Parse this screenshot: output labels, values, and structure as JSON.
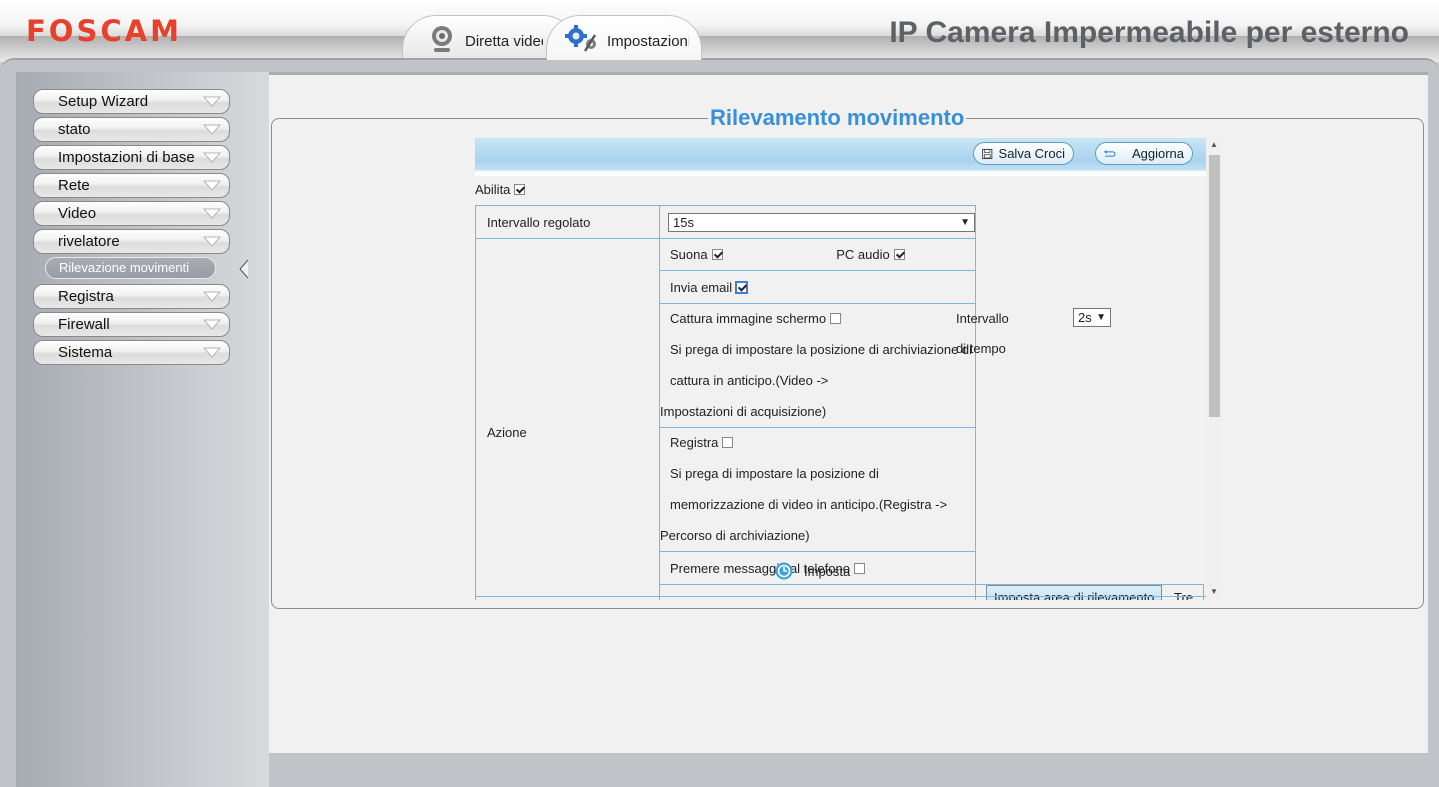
{
  "header": {
    "logo": "FOSCAM",
    "app_title": "IP Camera Impermeabile per esterno",
    "tabs": [
      {
        "label": "Diretta video",
        "icon": "webcam-icon"
      },
      {
        "label": "Impostazioni",
        "icon": "gears-icon"
      }
    ]
  },
  "sidebar": {
    "items": [
      {
        "label": "Setup Wizard"
      },
      {
        "label": "stato"
      },
      {
        "label": "Impostazioni di base"
      },
      {
        "label": "Rete"
      },
      {
        "label": "Video"
      },
      {
        "label": "rivelatore"
      },
      {
        "label": "Registra"
      },
      {
        "label": "Firewall"
      },
      {
        "label": "Sistema"
      }
    ],
    "active_sub": "Rilevazione movimenti"
  },
  "main": {
    "title": "Rilevamento movimento",
    "toolbar": {
      "save_label": "Salva Croci",
      "refresh_label": "Aggiorna"
    },
    "enable_label": "Abilita",
    "interval_label": "Intervallo regolato",
    "interval_value": "15s",
    "action_label": "Azione",
    "sound_label": "Suona",
    "pc_audio_label": "PC audio",
    "email_label": "Invia email",
    "snapshot_label": "Cattura immagine schermo",
    "time_interval_label": "Intervallo di tempo",
    "time_interval_value": "2s",
    "snapshot_note_1": "Si prega di impostare la posizione di archiviazione di cattura in anticipo.(Video ->",
    "snapshot_note_2": "Impostazioni di acquisizione)",
    "record_label": "Registra",
    "record_note_1": "Si prega di impostare la posizione di memorizzazione di video in anticipo.(Registra ->",
    "record_note_2": "Percorso di archiviazione)",
    "push_label": "Premere messaggio al telefono",
    "set_area_label": "Imposta area di rilevamento",
    "zones_note": "Tre zone al massimo",
    "apply_label": "Imposta"
  }
}
